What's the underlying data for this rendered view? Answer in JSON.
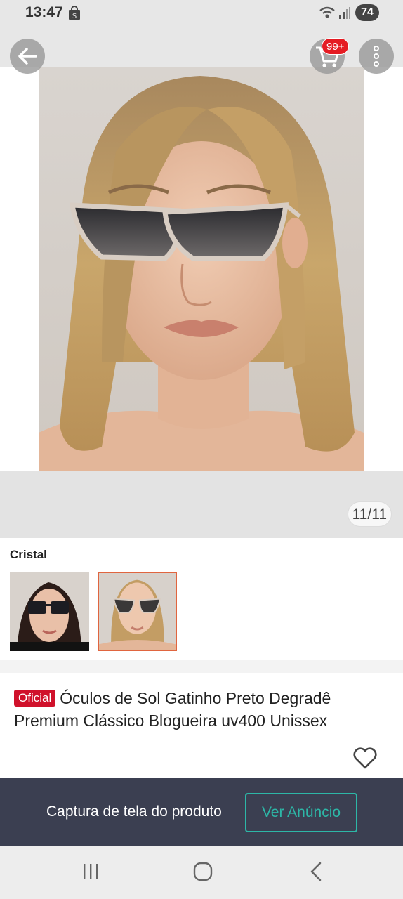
{
  "status_bar": {
    "time": "13:47",
    "battery": "74",
    "icons": [
      "shopping-bag-icon",
      "wifi-icon",
      "signal-icon"
    ]
  },
  "header": {
    "back_icon": "arrow-left-icon",
    "cart_icon": "cart-icon",
    "cart_badge": "99+",
    "more_icon": "more-vertical-icon"
  },
  "gallery": {
    "counter": "11/11"
  },
  "variation": {
    "label": "Cristal",
    "thumbnails": [
      "thumb-black-square-glasses",
      "thumb-clear-cateye-glasses"
    ],
    "selected_index": 1
  },
  "product": {
    "badge": "Oficial",
    "title": "Óculos de Sol Gatinho Preto Degradê Premium Clássico Blogueira uv400 Unissex",
    "favorite_icon": "heart-icon"
  },
  "cta": {
    "caption": "Captura de tela do produto",
    "button": "Ver Anúncio"
  },
  "nav": {
    "icons": [
      "recent-apps-icon",
      "home-icon",
      "back-icon"
    ]
  },
  "colors": {
    "accent_red": "#d0112b",
    "teal": "#2db7a7",
    "dark_bar": "#3b3f51",
    "selected_border": "#e0653f"
  }
}
